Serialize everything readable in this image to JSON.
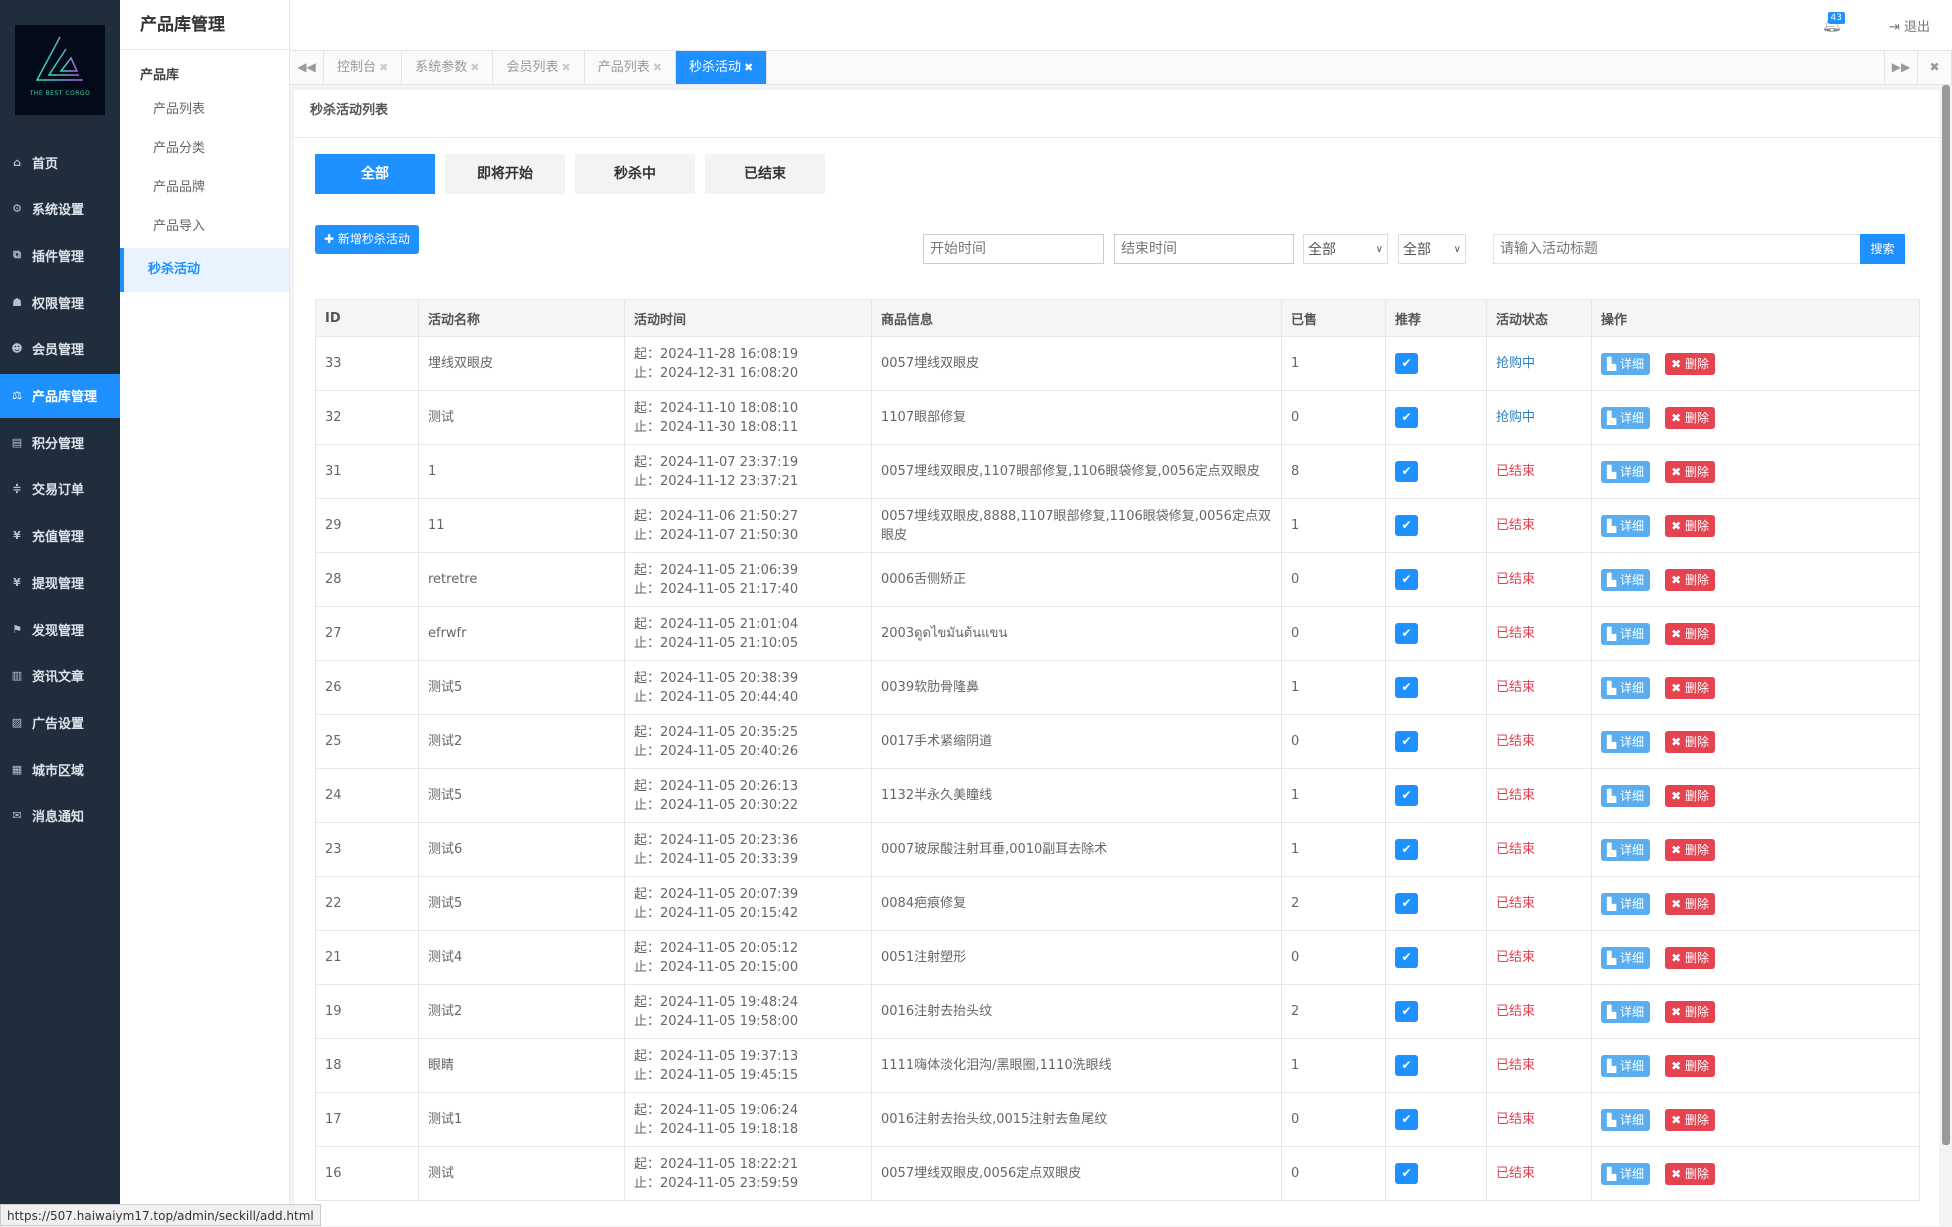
{
  "logo_text": "THE BEST CORGO",
  "sidebar": {
    "items": [
      {
        "label": "首页",
        "icon": "home-icon",
        "glyph": "⌂"
      },
      {
        "label": "系统设置",
        "icon": "gear-icon",
        "glyph": "⚙"
      },
      {
        "label": "插件管理",
        "icon": "plugin-icon",
        "glyph": "⧉"
      },
      {
        "label": "权限管理",
        "icon": "sitemap-icon",
        "glyph": "☗"
      },
      {
        "label": "会员管理",
        "icon": "users-icon",
        "glyph": "☻"
      },
      {
        "label": "产品库管理",
        "icon": "balance-icon",
        "glyph": "⚖"
      },
      {
        "label": "积分管理",
        "icon": "file-icon",
        "glyph": "▤"
      },
      {
        "label": "交易订单",
        "icon": "order-icon",
        "glyph": "≑"
      },
      {
        "label": "充值管理",
        "icon": "yen-icon",
        "glyph": "¥"
      },
      {
        "label": "提现管理",
        "icon": "yen-icon",
        "glyph": "¥"
      },
      {
        "label": "发现管理",
        "icon": "flag-icon",
        "glyph": "⚑"
      },
      {
        "label": "资讯文章",
        "icon": "newspaper-icon",
        "glyph": "▥"
      },
      {
        "label": "广告设置",
        "icon": "image-icon",
        "glyph": "▨"
      },
      {
        "label": "城市区域",
        "icon": "map-icon",
        "glyph": "▦"
      },
      {
        "label": "消息通知",
        "icon": "comment-icon",
        "glyph": "✉"
      }
    ],
    "active_index": 5
  },
  "subnav": {
    "title": "产品库管理",
    "group": "产品库",
    "items": [
      "产品列表",
      "产品分类",
      "产品品牌",
      "产品导入",
      "秒杀活动"
    ],
    "active": "秒杀活动"
  },
  "header": {
    "notification_count": "43",
    "logout": "退出"
  },
  "tabs": [
    {
      "label": "控制台"
    },
    {
      "label": "系统参数"
    },
    {
      "label": "会员列表"
    },
    {
      "label": "产品列表"
    },
    {
      "label": "秒杀活动",
      "active": true
    }
  ],
  "page": {
    "title": "秒杀活动列表",
    "filters": [
      "全部",
      "即将开始",
      "秒杀中",
      "已结束"
    ],
    "add_button": "新增秒杀活动",
    "start_time_placeholder": "开始时间",
    "end_time_placeholder": "结束时间",
    "select1": "全部",
    "select2": "全部",
    "search_placeholder": "请输入活动标题",
    "search_button": "搜索"
  },
  "table": {
    "columns": [
      "ID",
      "活动名称",
      "活动时间",
      "商品信息",
      "已售",
      "推荐",
      "活动状态",
      "操作"
    ],
    "start_prefix": "起：",
    "end_prefix": "止：",
    "detail": "详细",
    "delete": "删除",
    "rows": [
      {
        "id": "33",
        "name": "埋线双眼皮",
        "start": "2024-11-28 16:08:19",
        "end": "2024-12-31 16:08:20",
        "goods": "0057埋线双眼皮",
        "sold": "1",
        "recommend": true,
        "status": "抢购中"
      },
      {
        "id": "32",
        "name": "测试",
        "start": "2024-11-10 18:08:10",
        "end": "2024-11-30 18:08:11",
        "goods": "1107眼部修复",
        "sold": "0",
        "recommend": true,
        "status": "抢购中"
      },
      {
        "id": "31",
        "name": "1",
        "start": "2024-11-07 23:37:19",
        "end": "2024-11-12 23:37:21",
        "goods": "0057埋线双眼皮,1107眼部修复,1106眼袋修复,0056定点双眼皮",
        "sold": "8",
        "recommend": true,
        "status": "已结束"
      },
      {
        "id": "29",
        "name": "11",
        "start": "2024-11-06 21:50:27",
        "end": "2024-11-07 21:50:30",
        "goods": "0057埋线双眼皮,8888,1107眼部修复,1106眼袋修复,0056定点双眼皮",
        "sold": "1",
        "recommend": true,
        "status": "已结束"
      },
      {
        "id": "28",
        "name": "retretre",
        "start": "2024-11-05 21:06:39",
        "end": "2024-11-05 21:17:40",
        "goods": "0006舌侧矫正",
        "sold": "0",
        "recommend": true,
        "status": "已结束"
      },
      {
        "id": "27",
        "name": "efrwfr",
        "start": "2024-11-05 21:01:04",
        "end": "2024-11-05 21:10:05",
        "goods": "2003ดูดไขมันต้นแขน",
        "sold": "0",
        "recommend": true,
        "status": "已结束"
      },
      {
        "id": "26",
        "name": "测试5",
        "start": "2024-11-05 20:38:39",
        "end": "2024-11-05 20:44:40",
        "goods": "0039软肋骨隆鼻",
        "sold": "1",
        "recommend": true,
        "status": "已结束"
      },
      {
        "id": "25",
        "name": "测试2",
        "start": "2024-11-05 20:35:25",
        "end": "2024-11-05 20:40:26",
        "goods": "0017手术紧缩阴道",
        "sold": "0",
        "recommend": true,
        "status": "已结束"
      },
      {
        "id": "24",
        "name": "测试5",
        "start": "2024-11-05 20:26:13",
        "end": "2024-11-05 20:30:22",
        "goods": "1132半永久美瞳线",
        "sold": "1",
        "recommend": true,
        "status": "已结束"
      },
      {
        "id": "23",
        "name": "测试6",
        "start": "2024-11-05 20:23:36",
        "end": "2024-11-05 20:33:39",
        "goods": "0007玻尿酸注射耳垂,0010副耳去除术",
        "sold": "1",
        "recommend": true,
        "status": "已结束"
      },
      {
        "id": "22",
        "name": "测试5",
        "start": "2024-11-05 20:07:39",
        "end": "2024-11-05 20:15:42",
        "goods": "0084疤痕修复",
        "sold": "2",
        "recommend": true,
        "status": "已结束"
      },
      {
        "id": "21",
        "name": "测试4",
        "start": "2024-11-05 20:05:12",
        "end": "2024-11-05 20:15:00",
        "goods": "0051注射塑形",
        "sold": "0",
        "recommend": true,
        "status": "已结束"
      },
      {
        "id": "19",
        "name": "测试2",
        "start": "2024-11-05 19:48:24",
        "end": "2024-11-05 19:58:00",
        "goods": "0016注射去抬头纹",
        "sold": "2",
        "recommend": true,
        "status": "已结束"
      },
      {
        "id": "18",
        "name": "眼睛",
        "start": "2024-11-05 19:37:13",
        "end": "2024-11-05 19:45:15",
        "goods": "1111嗨体淡化泪沟/黑眼圈,1110洗眼线",
        "sold": "1",
        "recommend": true,
        "status": "已结束"
      },
      {
        "id": "17",
        "name": "测试1",
        "start": "2024-11-05 19:06:24",
        "end": "2024-11-05 19:18:18",
        "goods": "0016注射去抬头纹,0015注射去鱼尾纹",
        "sold": "0",
        "recommend": true,
        "status": "已结束"
      },
      {
        "id": "16",
        "name": "测试",
        "start": "2024-11-05 18:22:21",
        "end": "2024-11-05 23:59:59",
        "goods": "0057埋线双眼皮,0056定点双眼皮",
        "sold": "0",
        "recommend": true,
        "status": "已结束"
      }
    ]
  },
  "status_bar_url": "https://507.haiwaiym17.top/admin/seckill/add.html",
  "colors": {
    "primary": "#1e90ff",
    "sidebar": "#1f2d3d",
    "ongoing": "#2b7fc4",
    "ended": "#e04050",
    "delete": "#e5434f"
  }
}
